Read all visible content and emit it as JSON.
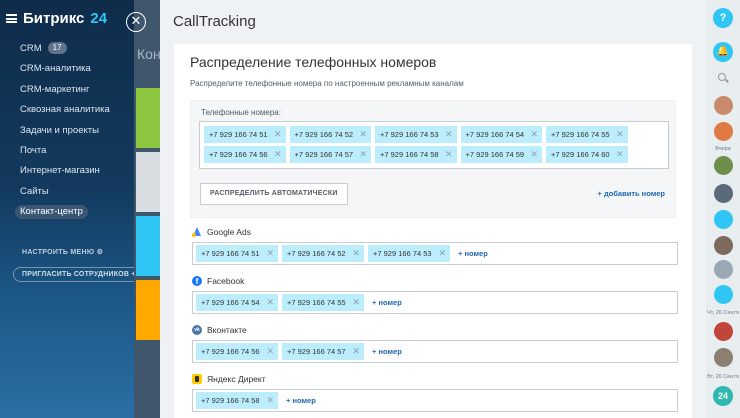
{
  "app": {
    "brand_name": "Битрикс",
    "brand_suffix": "24",
    "menu": [
      {
        "label": "CRM",
        "badge": "17"
      },
      {
        "label": "CRM-аналитика"
      },
      {
        "label": "CRM-маркетинг"
      },
      {
        "label": "Сквозная аналитика"
      },
      {
        "label": "Задачи и проекты"
      },
      {
        "label": "Почта"
      },
      {
        "label": "Интернет-магазин"
      },
      {
        "label": "Сайты"
      },
      {
        "label": "Контакт-центр",
        "active": true
      }
    ],
    "setup_menu": "НАСТРОИТЬ МЕНЮ",
    "invite": "ПРИГЛАСИТЬ СОТРУДНИКОВ +",
    "background_title": "Кон"
  },
  "slider": {
    "title": "CallTracking",
    "card": {
      "heading": "Распределение телефонных номеров",
      "subtitle": "Распределите телефонные номера по настроенным рекламным каналам",
      "numbers_label": "Телефонные номера:",
      "numbers": [
        "+7 929 166 74 51",
        "+7 929 166 74 52",
        "+7 929 166 74 53",
        "+7 929 166 74 54",
        "+7 929 166 74 55",
        "+7 929 166 74 56",
        "+7 929 166 74 57",
        "+7 929 166 74 58",
        "+7 929 166 74 59",
        "+7 929 166 74 60"
      ],
      "auto_button": "РАСПРЕДЕЛИТЬ АВТОМАТИЧЕСКИ",
      "add_number": "+ добавить номер",
      "channels": [
        {
          "name": "Google Ads",
          "icon": "google-ads-icon",
          "numbers": [
            "+7 929 166 74 51",
            "+7 929 166 74 52",
            "+7 929 166 74 53"
          ],
          "add": "+ номер"
        },
        {
          "name": "Facebook",
          "icon": "facebook-icon",
          "numbers": [
            "+7 929 166 74 54",
            "+7 929 166 74 55"
          ],
          "add": "+ номер"
        },
        {
          "name": "Вконтакте",
          "icon": "vk-icon",
          "numbers": [
            "+7 929 166 74 56",
            "+7 929 166 74 57"
          ],
          "add": "+ номер"
        },
        {
          "name": "Яндекс Директ",
          "icon": "yandex-direct-icon",
          "numbers": [
            "+7 929 166 74 58"
          ],
          "add": "+ номер"
        }
      ]
    }
  },
  "rail": {
    "help": "?",
    "date_1": "Вчера",
    "date_2": "Чт, 26 Сентя",
    "date_3": "Вт, 26 Сентя",
    "bitrix_badge": "24"
  },
  "colors": {
    "accent": "#2fc6f6",
    "tag_bg": "#bcedfc",
    "link": "#2067b0"
  }
}
